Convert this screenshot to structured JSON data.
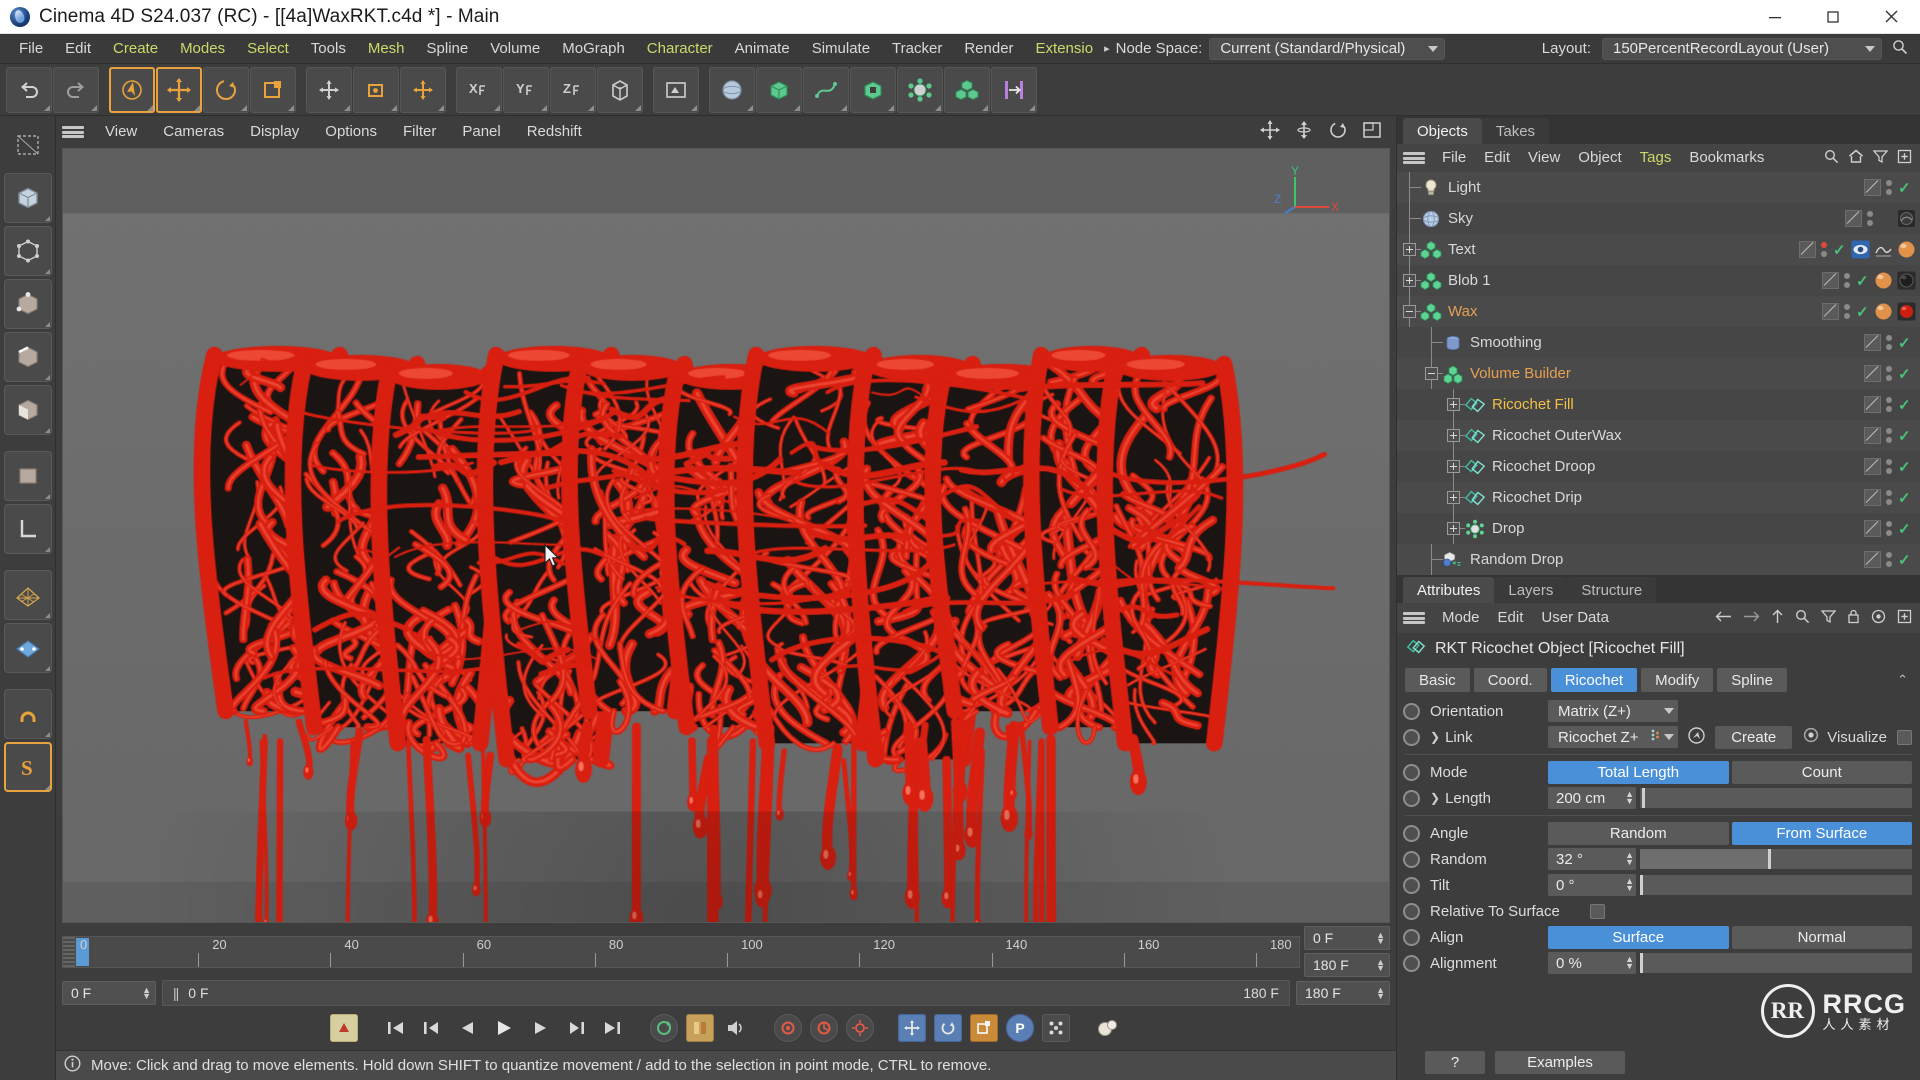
{
  "window": {
    "title": "Cinema 4D S24.037 (RC) - [[4a]WaxRKT.c4d *] - Main",
    "minimize": "—",
    "maximize": "☐",
    "close": "✕"
  },
  "menubar": {
    "items": [
      {
        "label": "File",
        "accent": false
      },
      {
        "label": "Edit",
        "accent": false
      },
      {
        "label": "Create",
        "accent": true
      },
      {
        "label": "Modes",
        "accent": true
      },
      {
        "label": "Select",
        "accent": true
      },
      {
        "label": "Tools",
        "accent": false
      },
      {
        "label": "Mesh",
        "accent": true
      },
      {
        "label": "Spline",
        "accent": false
      },
      {
        "label": "Volume",
        "accent": false
      },
      {
        "label": "MoGraph",
        "accent": false
      },
      {
        "label": "Character",
        "accent": true
      },
      {
        "label": "Animate",
        "accent": false
      },
      {
        "label": "Simulate",
        "accent": false
      },
      {
        "label": "Tracker",
        "accent": false
      },
      {
        "label": "Render",
        "accent": false
      },
      {
        "label": "Extensio",
        "accent": true
      }
    ],
    "overflow_arrow": "▸",
    "node_space_label": "Node Space:",
    "node_space_value": "Current (Standard/Physical)",
    "layout_label": "Layout:",
    "layout_value": "150PercentRecordLayout (User)",
    "search_icon": "search-icon"
  },
  "toolbar": {
    "undo": "undo-icon",
    "redo": "redo-icon",
    "tools": [
      {
        "name": "select-tool",
        "state": "active"
      },
      {
        "name": "move-tool",
        "state": "active"
      },
      {
        "name": "rotate-tool",
        "state": "framed"
      },
      {
        "name": "scale-tool",
        "state": "framed"
      },
      {
        "name": "world-object-axis-tool",
        "state": "framed"
      },
      {
        "name": "object-axis-tool",
        "state": "framed"
      },
      {
        "name": "axis-move-tool",
        "state": "framed"
      },
      {
        "name": "lock-x-axis",
        "state": "framed"
      },
      {
        "name": "lock-y-axis",
        "state": "framed"
      },
      {
        "name": "lock-z-axis",
        "state": "framed"
      },
      {
        "name": "world-coordinate-system",
        "state": "framed"
      },
      {
        "name": "render-view-icon",
        "state": "framed"
      },
      {
        "name": "primitive-sphere-icon",
        "state": "framed"
      },
      {
        "name": "primitive-cube-icon",
        "state": "framed"
      },
      {
        "name": "spline-pen-icon",
        "state": "framed"
      },
      {
        "name": "generator-icon",
        "state": "framed"
      },
      {
        "name": "deformer-icon",
        "state": "framed"
      },
      {
        "name": "scene-environment-icon",
        "state": "framed"
      },
      {
        "name": "mograph-icon",
        "state": "framed"
      },
      {
        "name": "transform-icon",
        "state": "framed"
      }
    ]
  },
  "leftbar": {
    "items": [
      {
        "name": "texture-axis-icon",
        "state": "plain"
      },
      {
        "name": "model-mode-icon",
        "state": "framed"
      },
      {
        "name": "object-mode-icon",
        "state": "framed"
      },
      {
        "name": "point-mode-icon",
        "state": "framed"
      },
      {
        "name": "edge-mode-icon",
        "state": "framed"
      },
      {
        "name": "polygon-mode-icon",
        "state": "framed"
      },
      {
        "name": "texture-mode-icon",
        "state": "framed"
      },
      {
        "name": "workplane-icon",
        "state": "framed"
      },
      {
        "name": "enable-axis-icon",
        "state": "framed"
      },
      {
        "name": "uv-points-icon",
        "state": "framed"
      },
      {
        "name": "snap-magnet-icon",
        "state": "framed"
      },
      {
        "name": "s-snap-icon",
        "state": "selected"
      }
    ]
  },
  "viewport_menu": {
    "hamburger": "hamburger-icon",
    "items": [
      {
        "label": "View"
      },
      {
        "label": "Cameras"
      },
      {
        "label": "Display"
      },
      {
        "label": "Options"
      },
      {
        "label": "Filter"
      },
      {
        "label": "Panel"
      },
      {
        "label": "Redshift"
      }
    ],
    "icons": [
      "pan-icon",
      "dolly-icon",
      "rotate-icon",
      "maximize-view-icon"
    ],
    "axis": {
      "x": "X",
      "y": "Y",
      "z": "Z"
    }
  },
  "timeline": {
    "ticks": [
      {
        "label": "0",
        "value": 0
      },
      {
        "label": "20",
        "value": 20
      },
      {
        "label": "40",
        "value": 40
      },
      {
        "label": "60",
        "value": 60
      },
      {
        "label": "80",
        "value": 80
      },
      {
        "label": "100",
        "value": 100
      },
      {
        "label": "120",
        "value": 120
      },
      {
        "label": "140",
        "value": 140
      },
      {
        "label": "160",
        "value": 160
      },
      {
        "label": "180",
        "value": 180
      }
    ],
    "current_frame_top": "0 F",
    "end_frame_top": "180 F",
    "current_frame_left": "0 F",
    "preview_start": "0 F",
    "preview_end": "180 F",
    "max_frame": "180 F",
    "pause_glyph": "||"
  },
  "transport": {
    "buttons": [
      {
        "name": "record-active-objects-button",
        "glyph": ""
      },
      {
        "name": "go-to-start-button",
        "glyph": "⏮"
      },
      {
        "name": "go-to-previous-key-button",
        "glyph": "⏴|"
      },
      {
        "name": "go-to-previous-frame-button",
        "glyph": "◀"
      },
      {
        "name": "play-button",
        "glyph": "▶"
      },
      {
        "name": "go-to-next-frame-button",
        "glyph": "▶|"
      },
      {
        "name": "go-to-next-key-button",
        "glyph": "⏭"
      },
      {
        "name": "go-to-end-button",
        "glyph": "⏭"
      },
      {
        "name": "loop-playback-button",
        "glyph": "↻"
      },
      {
        "name": "record-keyframe-button",
        "glyph": ""
      },
      {
        "name": "autokeying-button",
        "glyph": ""
      },
      {
        "name": "keyframe-selection-button",
        "glyph": ""
      },
      {
        "name": "position-keyframe-button",
        "glyph": ""
      },
      {
        "name": "rotation-keyframe-button",
        "glyph": ""
      },
      {
        "name": "scale-keyframe-button",
        "glyph": ""
      },
      {
        "name": "parameter-keyframe-button",
        "glyph": "P"
      },
      {
        "name": "point-level-animation-button",
        "glyph": ""
      },
      {
        "name": "simulate-button",
        "glyph": ""
      }
    ]
  },
  "statusbar": {
    "icon": "info-icon",
    "message": "Move: Click and drag to move elements. Hold down SHIFT to quantize movement / add to the selection in point mode, CTRL to remove."
  },
  "object_manager": {
    "tabs": [
      {
        "label": "Objects",
        "active": true
      },
      {
        "label": "Takes",
        "active": false
      }
    ],
    "menu": [
      {
        "label": "File",
        "accent": false
      },
      {
        "label": "Edit",
        "accent": false
      },
      {
        "label": "View",
        "accent": false
      },
      {
        "label": "Object",
        "accent": false
      },
      {
        "label": "Tags",
        "accent": true
      },
      {
        "label": "Bookmarks",
        "accent": false
      }
    ],
    "menu_icons": [
      "search-icon",
      "home-icon",
      "filter-icon",
      "add-layer-icon"
    ],
    "rows": [
      {
        "name": "Light",
        "icon": "light-bulb-icon",
        "depth": 1,
        "expander": "none",
        "color": "default",
        "check": true,
        "dots": "gray",
        "tags": []
      },
      {
        "name": "Sky",
        "icon": "sky-globe-icon",
        "depth": 1,
        "expander": "none",
        "color": "default",
        "check": false,
        "dots": "gray",
        "tags": [
          "sky-texture-tag"
        ]
      },
      {
        "name": "Text",
        "icon": "polygon-group-icon",
        "depth": 1,
        "expander": "plus",
        "color": "default",
        "check": true,
        "dots": "red",
        "tags": [
          "display-tag",
          "phong-tag",
          "material-tag"
        ]
      },
      {
        "name": "Blob 1",
        "icon": "polygon-group-icon",
        "depth": 1,
        "expander": "plus",
        "color": "default",
        "check": true,
        "dots": "gray",
        "tags": [
          "material-tag",
          "texture-sphere-tag"
        ]
      },
      {
        "name": "Wax",
        "icon": "polygon-group-icon",
        "depth": 1,
        "expander": "minus",
        "color": "orange",
        "check": true,
        "dots": "gray",
        "tags": [
          "material-tag",
          "red-material-tag"
        ]
      },
      {
        "name": "Smoothing",
        "icon": "volume-mesher-icon",
        "depth": 2,
        "expander": "none",
        "color": "default",
        "check": true,
        "dots": "gray",
        "tags": []
      },
      {
        "name": "Volume Builder",
        "icon": "volume-builder-icon",
        "depth": 2,
        "expander": "minus",
        "color": "orange",
        "check": true,
        "dots": "gray",
        "tags": []
      },
      {
        "name": "Ricochet Fill",
        "icon": "ricochet-icon",
        "depth": 3,
        "expander": "plus",
        "color": "gold",
        "check": true,
        "dots": "gray",
        "tags": []
      },
      {
        "name": "Ricochet OuterWax",
        "icon": "ricochet-icon",
        "depth": 3,
        "expander": "plus",
        "color": "default",
        "check": true,
        "dots": "gray",
        "tags": []
      },
      {
        "name": "Ricochet Droop",
        "icon": "ricochet-icon",
        "depth": 3,
        "expander": "plus",
        "color": "default",
        "check": true,
        "dots": "gray",
        "tags": []
      },
      {
        "name": "Ricochet Drip",
        "icon": "ricochet-icon",
        "depth": 3,
        "expander": "plus",
        "color": "default",
        "check": true,
        "dots": "gray",
        "tags": []
      },
      {
        "name": "Drop",
        "icon": "cloner-icon",
        "depth": 3,
        "expander": "plus",
        "color": "default",
        "check": true,
        "dots": "gray",
        "tags": []
      },
      {
        "name": "Random Drop",
        "icon": "random-effector-icon",
        "depth": 2,
        "expander": "none",
        "color": "default",
        "check": true,
        "dots": "gray",
        "tags": []
      }
    ]
  },
  "attributes": {
    "tabs": [
      {
        "label": "Attributes",
        "active": true
      },
      {
        "label": "Layers",
        "active": false
      },
      {
        "label": "Structure",
        "active": false
      }
    ],
    "menu": [
      {
        "label": "Mode"
      },
      {
        "label": "Edit"
      },
      {
        "label": "User Data"
      }
    ],
    "menu_icons": [
      "back-arrow-icon",
      "forward-arrow-icon",
      "up-arrow-icon",
      "search-icon",
      "filter-icon",
      "lock-icon",
      "target-icon",
      "add-icon"
    ],
    "object_title": "RKT Ricochet Object [Ricochet Fill]",
    "object_icon": "ricochet-icon",
    "pills": [
      {
        "label": "Basic",
        "active": false
      },
      {
        "label": "Coord.",
        "active": false
      },
      {
        "label": "Ricochet",
        "active": true
      },
      {
        "label": "Modify",
        "active": false
      },
      {
        "label": "Spline",
        "active": false
      }
    ],
    "collapse_arrow": "⌃",
    "params": [
      {
        "name": "Orientation",
        "type": "select",
        "value": "Matrix (Z+)",
        "expandable": false
      },
      {
        "name": "Link",
        "type": "link",
        "value": "Ricochet Z+",
        "expandable": true,
        "buttons": [
          {
            "label": "Create"
          }
        ],
        "checkbox_label": "Visualize",
        "checked": false
      },
      {
        "name": "Mode",
        "type": "segment",
        "options": [
          "Total Length",
          "Count"
        ],
        "selected": "Total Length",
        "expandable": false
      },
      {
        "name": "Length",
        "type": "spinner-slider",
        "value": "200 cm",
        "expandable": true,
        "fill_pct": 2
      },
      {
        "name": "Angle",
        "type": "segment",
        "options": [
          "Random",
          "From Surface"
        ],
        "selected": "From Surface",
        "expandable": false
      },
      {
        "name": "Random",
        "type": "spinner-slider",
        "value": "32 °",
        "expandable": false,
        "fill_pct": 47
      },
      {
        "name": "Tilt",
        "type": "spinner-slider",
        "value": "0 °",
        "expandable": false,
        "fill_pct": 0
      },
      {
        "name": "Relative To Surface",
        "type": "checkbox",
        "checked": false,
        "expandable": false
      },
      {
        "name": "Align",
        "type": "segment",
        "options": [
          "Surface",
          "Normal"
        ],
        "selected": "Surface",
        "expandable": false
      },
      {
        "name": "Alignment",
        "type": "spinner-slider",
        "value": "0 %",
        "expandable": false,
        "fill_pct": 0
      }
    ],
    "footer": {
      "help_label": "?",
      "examples_label": "Examples"
    }
  },
  "watermark": {
    "mark": "RR",
    "big": "RRCG",
    "small": "人人素材"
  },
  "colors": {
    "accent_blue": "#4a90d9",
    "accent_yellow": "#cfd96a",
    "orange": "#e5a053",
    "gold": "#f2c045",
    "green_check": "#49c17a",
    "panel_bg": "#3d3d3d",
    "tree_bg": "#4a4a4a",
    "viewport_bg": "#6e6e6e",
    "wax_red": "#d81f10"
  }
}
